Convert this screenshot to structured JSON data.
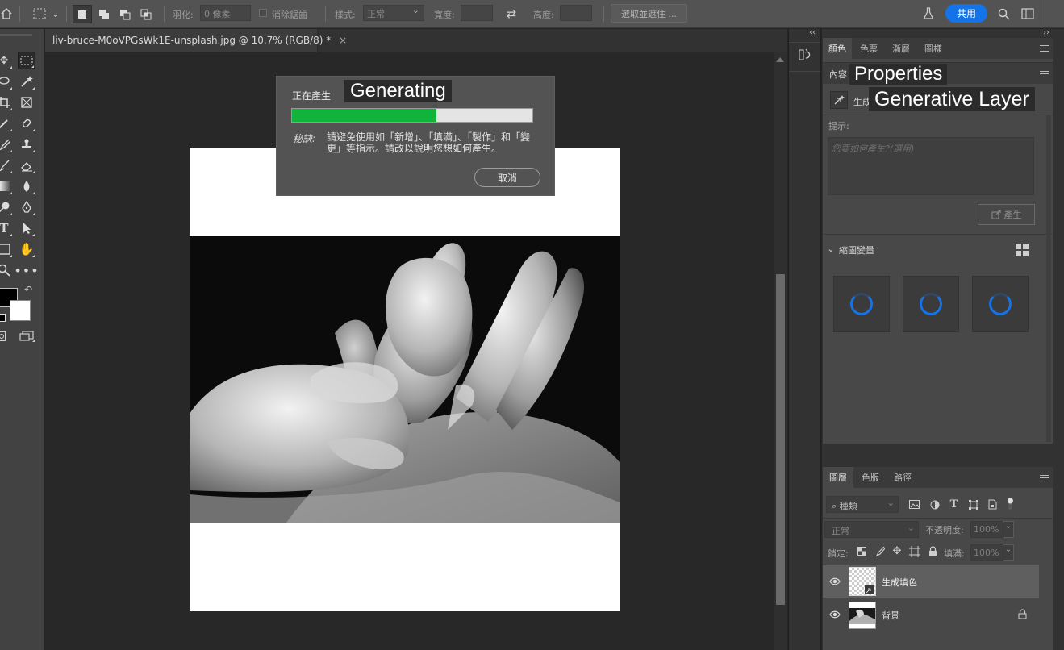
{
  "options_bar": {
    "feather_label": "羽化:",
    "feather_value": "0 像素",
    "antialias_label": "消除鋸齒",
    "style_label": "樣式:",
    "style_value": "正常",
    "width_label": "寬度:",
    "height_label": "高度:",
    "select_mask_label": "選取並遮住 ...",
    "share_label": "共用"
  },
  "document": {
    "tab_title": "liv-bruce-M0oVPGsWk1E-unsplash.jpg @ 10.7% (RGB/8) *",
    "close_glyph": "×"
  },
  "dialog": {
    "title": "正在產生",
    "caption": "Generating",
    "progress_fraction": 0.6,
    "tip_label": "秘訣:",
    "tip_text": "請避免使用如「新增」、「填滿」、「製作」和「變更」等指示。請改以說明您想如何產生。",
    "cancel_label": "取消",
    "progress_color": "#12b33a"
  },
  "color_panel": {
    "tabs": [
      "顏色",
      "色票",
      "漸層",
      "圖樣"
    ]
  },
  "properties_panel": {
    "header_label": "內容",
    "caption": "Properties",
    "layer_type_label": "生成",
    "layer_caption": "Generative Layer",
    "prompt_label": "提示:",
    "prompt_placeholder": "您要如何產生?(選用)",
    "generate_label": "產生",
    "variations_label": "縮圖變量"
  },
  "layers_panel": {
    "tabs": [
      "圖層",
      "色版",
      "路徑"
    ],
    "filter_value": "種類",
    "blend_mode": "正常",
    "opacity_label": "不透明度:",
    "opacity_value": "100%",
    "lock_label": "鎖定:",
    "fill_label": "填滿:",
    "fill_value": "100%",
    "layers": [
      {
        "name": "生成填色",
        "selected": true,
        "locked": false
      },
      {
        "name": "背景",
        "selected": false,
        "locked": true
      }
    ]
  },
  "colors": {
    "accent": "#1473e6",
    "progress": "#12b33a"
  }
}
